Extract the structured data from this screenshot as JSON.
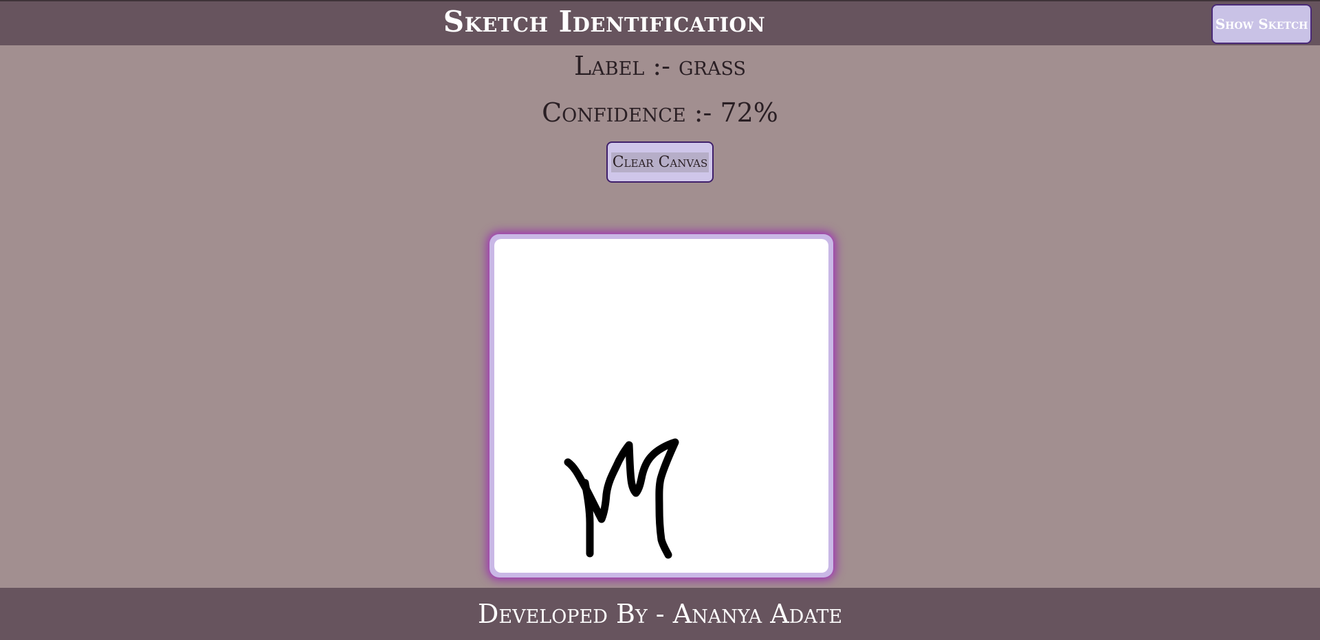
{
  "header": {
    "title": "Sketch Identification",
    "show_sketch_label": "Show Sketch"
  },
  "result": {
    "label_text": "Label :- grass",
    "confidence_text": "Confidence :- 72%"
  },
  "controls": {
    "clear_canvas_label": "Clear Canvas"
  },
  "canvas": {
    "stroke_color": "#000000"
  },
  "footer": {
    "credit": "Developed By - Ananya Adate"
  },
  "colors": {
    "bar": "#67545e",
    "background": "#a28f90",
    "button": "#c9c2e6",
    "canvas_glow": "#9a3aa8"
  }
}
